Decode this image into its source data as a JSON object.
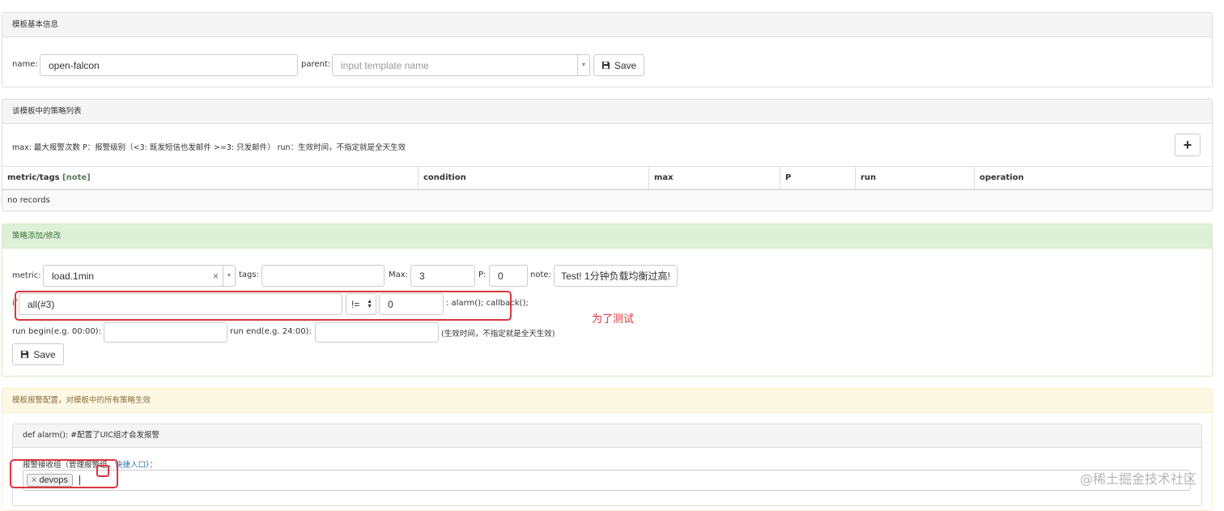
{
  "panel1": {
    "title": "模板基本信息",
    "name_label": "name:",
    "name_value": "open-falcon",
    "parent_label": "parent:",
    "parent_placeholder": "input template name",
    "save_label": "Save"
  },
  "panel2": {
    "title": "该模板中的策略列表",
    "legend": "max: 最大报警次数 P：报警级别（<3: 既发短信也发邮件 >=3: 只发邮件） run：生效时间，不指定就是全天生效",
    "add_label": "+",
    "columns": {
      "metric_tags": "metric/tags",
      "note": "[note]",
      "condition": "condition",
      "max": "max",
      "p": "P",
      "run": "run",
      "operation": "operation"
    },
    "empty": "no records"
  },
  "panel3": {
    "title": "策略添加/修改",
    "metric_label": "metric:",
    "metric_value": "load.1min",
    "clear": "×",
    "tags_label": "tags:",
    "max_label": "Max:",
    "max_value": "3",
    "p_label": "P:",
    "p_value": "0",
    "note_label": "note:",
    "note_value": "Test! 1分钟负载均衡过高!",
    "if_label": "if",
    "func_value": "all(#3)",
    "op_value": "!=",
    "threshold_value": "0",
    "then_text": ": alarm(); callback();",
    "annotation": "为了测试",
    "run_begin_label": "run begin(e.g. 00:00):",
    "run_end_label": "run end(e.g. 24:00):",
    "run_hint": "(生效时间，不指定就是全天生效)",
    "save_label": "Save"
  },
  "panel4": {
    "title": "模板报警配置，对模板中的所有策略生效",
    "sub_title": "def alarm(): #配置了UIC组才会发报警",
    "groups_label_prefix": "报警接收组（管理报警组，",
    "groups_link": "快捷入口",
    "groups_label_suffix": "）：",
    "tag_remove": "×",
    "tag_value": "devops"
  },
  "watermark": "@稀土掘金技术社区",
  "colors": {
    "annotation_red": "#d9363e",
    "link": "#337ab7",
    "green_header": "#dff0d8",
    "yellow_header": "#fcf8e3"
  }
}
